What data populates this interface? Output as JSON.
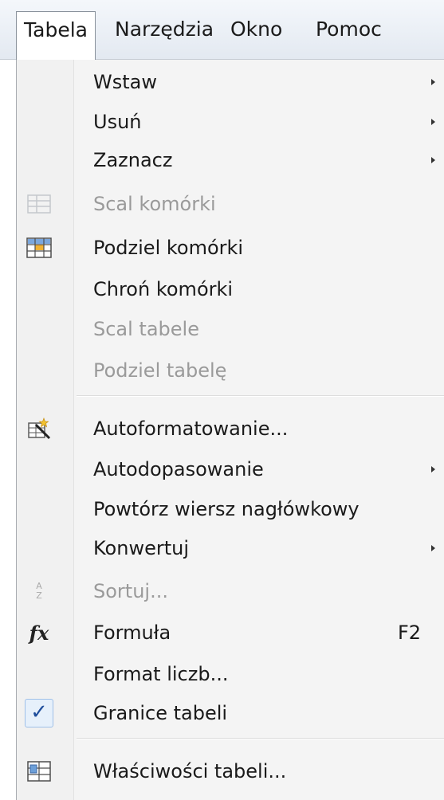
{
  "menubar": {
    "items": [
      {
        "label": "Tabela",
        "active": true
      },
      {
        "label": "Narzędzia"
      },
      {
        "label": "Okno"
      },
      {
        "label": "Pomoc"
      }
    ]
  },
  "menu": {
    "items": [
      {
        "label": "Wstaw",
        "submenu": true
      },
      {
        "label": "Usuń",
        "submenu": true
      },
      {
        "label": "Zaznacz",
        "submenu": true
      },
      {
        "label": "Scal komórki",
        "disabled": true,
        "icon": "merge-cells-icon"
      },
      {
        "label": "Podziel komórki",
        "icon": "split-cells-icon"
      },
      {
        "label": "Chroń komórki"
      },
      {
        "label": "Scal tabele",
        "disabled": true
      },
      {
        "label": "Podziel tabelę",
        "disabled": true
      },
      {
        "label": "Autoformatowanie...",
        "icon": "autoformat-icon"
      },
      {
        "label": "Autodopasowanie",
        "submenu": true
      },
      {
        "label": "Powtórz wiersz nagłówkowy"
      },
      {
        "label": "Konwertuj",
        "submenu": true
      },
      {
        "label": "Sortuj...",
        "disabled": true,
        "icon": "sort-icon"
      },
      {
        "label": "Formuła",
        "shortcut": "F2",
        "icon": "formula-icon"
      },
      {
        "label": "Format liczb..."
      },
      {
        "label": "Granice tabeli",
        "checked": true,
        "icon": "checkmark-icon"
      },
      {
        "label": "Właściwości tabeli...",
        "icon": "table-properties-icon"
      }
    ],
    "sort_icon_text": "A Z",
    "formula_icon_text": "fx",
    "check_glyph": "✓"
  }
}
